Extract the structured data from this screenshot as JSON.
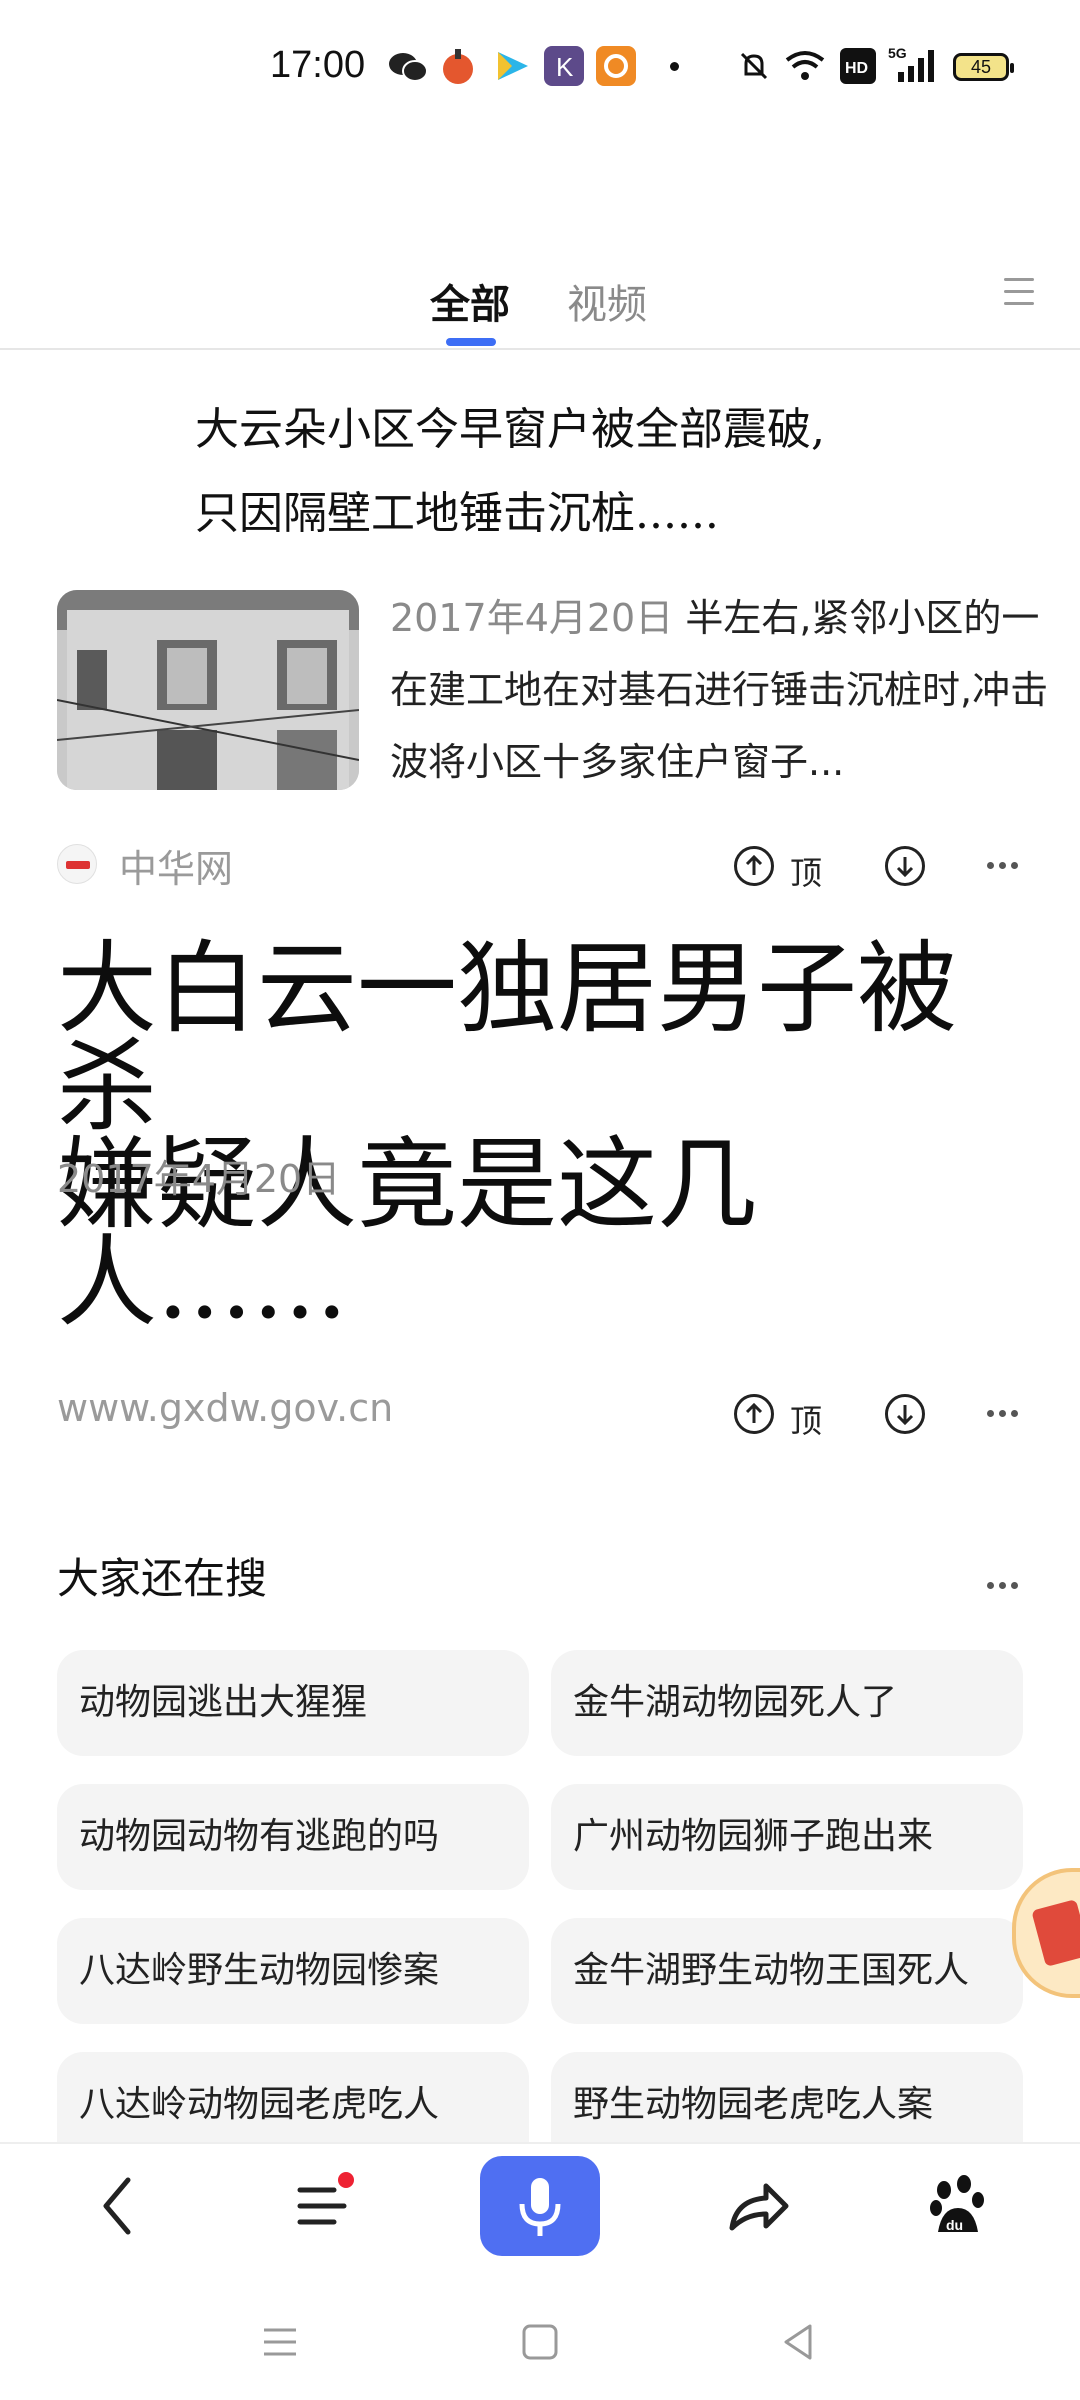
{
  "status_bar": {
    "time": "17:00",
    "battery": "45",
    "icons": [
      "wechat-icon",
      "app-icon",
      "video-icon",
      "k-app-icon",
      "browser-icon",
      "dot-icon",
      "mute-icon",
      "wifi-icon",
      "hd-icon",
      "5g-signal-icon",
      "battery-icon"
    ]
  },
  "tabs": {
    "items": [
      "全部",
      "视频"
    ],
    "active": "全部"
  },
  "article1": {
    "headline": [
      "大云朵小区今早窗户被全部震破,",
      "只因隔壁工地锤击沉桩......"
    ],
    "date": "2017年4月20日",
    "snippet_rest": " 半左右,紧邻小区的一在建工地在对基石进行锤击沉桩时,冲击波将小区十多家住户窗子...",
    "source": "中华网",
    "upvote_label": "顶"
  },
  "article2": {
    "headline": [
      "大白云一独居男子被杀",
      "嫌疑人竟是这几人......"
    ],
    "date": "2017年4月20日",
    "source": "www.gxdw.gov.cn",
    "upvote_label": "顶"
  },
  "related": {
    "title": "大家还在搜",
    "chips": [
      "动物园逃出大猩猩",
      "金牛湖动物园死人了",
      "动物园动物有逃跑的吗",
      "广州动物园狮子跑出来",
      "八达岭野生动物园惨案",
      "金牛湖野生动物王国死人",
      "八达岭动物园老虎吃人",
      "野生动物园老虎吃人案"
    ]
  },
  "toolbar": {
    "items": [
      "back-icon",
      "menu-list-icon",
      "microphone-icon",
      "share-icon",
      "baidu-paw-icon"
    ]
  },
  "colors": {
    "accent": "#3d6ef5",
    "voice_button": "#4f6ff2",
    "chip_bg": "#f4f4f4",
    "muted_text": "#8a8a8a",
    "notification_red": "#ee2233"
  }
}
